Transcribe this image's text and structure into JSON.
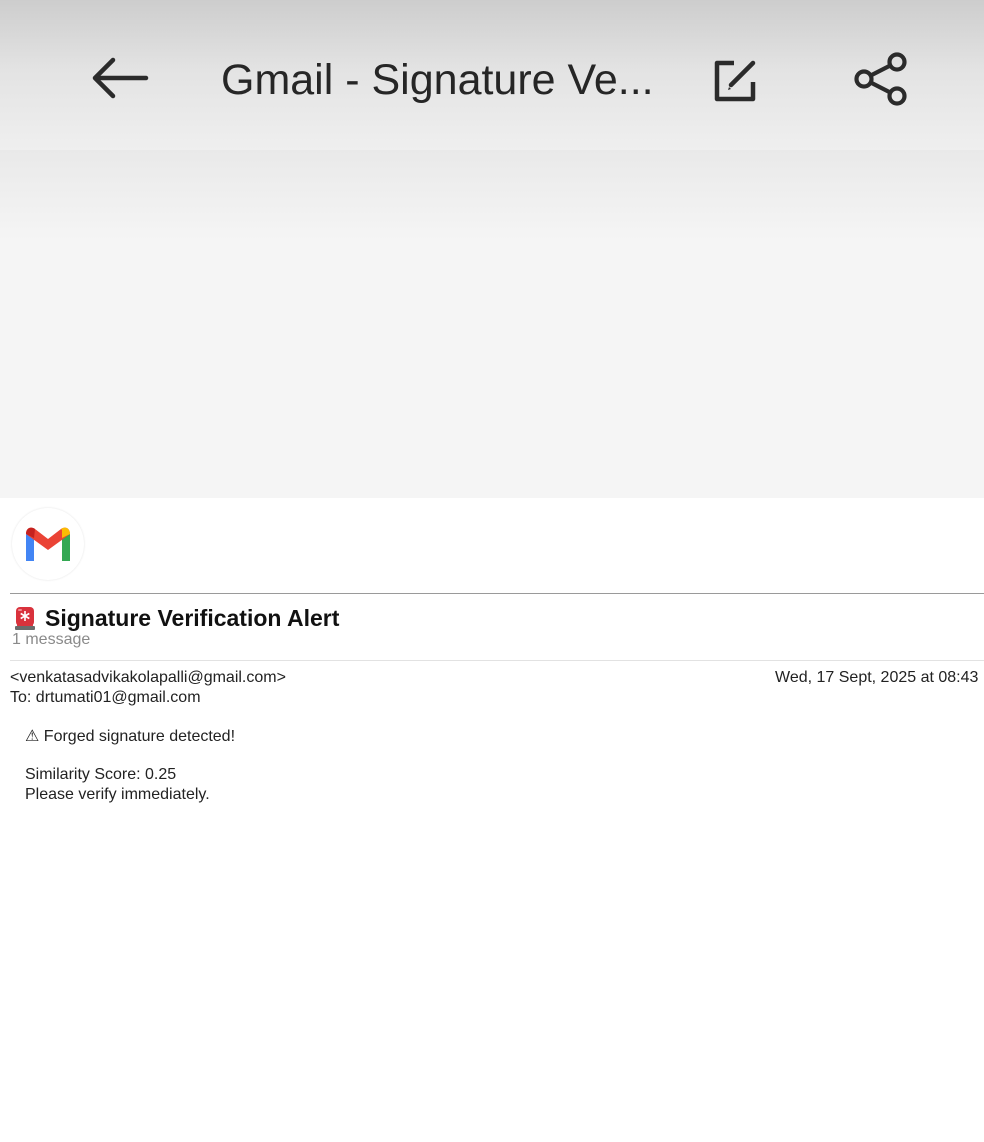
{
  "toolbar": {
    "title": "Gmail -  Signature Ve...",
    "back_icon": "arrow-left-icon",
    "edit_icon": "edit-note-icon",
    "share_icon": "share-icon"
  },
  "email": {
    "logo_icon": "gmail-logo",
    "subject_icon": "rotating-light-icon",
    "subject": "Signature Verification Alert",
    "message_count": "1 message",
    "from": "<venkatasadvikakolapalli@gmail.com>",
    "date": "Wed, 17 Sept, 2025 at 08:43",
    "to": "To: drtumati01@gmail.com",
    "body": {
      "line1": "⚠ Forged signature detected!",
      "line2": "Similarity Score: 0.25",
      "line3": "Please verify immediately."
    }
  },
  "colors": {
    "gmail_red": "#EA4335",
    "gmail_blue": "#4285F4",
    "gmail_green": "#34A853",
    "gmail_yellow": "#FBBC04",
    "gmail_dark_red": "#C5221F",
    "icon_dark": "#2b2b2b"
  }
}
